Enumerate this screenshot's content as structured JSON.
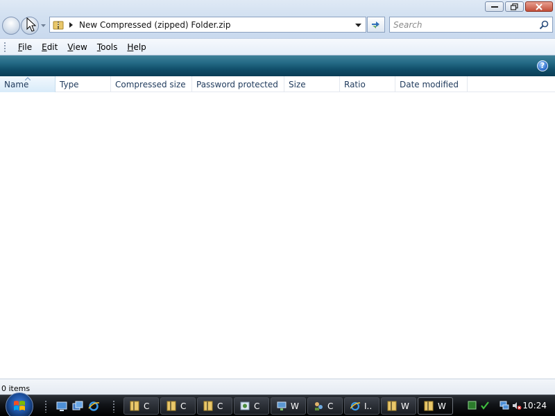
{
  "window": {
    "minimize_label": "minimize",
    "maximize_label": "maximize",
    "close_label": "close"
  },
  "address": {
    "path": "New Compressed (zipped) Folder.zip"
  },
  "search": {
    "placeholder": "Search"
  },
  "menu": {
    "items": [
      {
        "label": "File",
        "key": "F",
        "rest": "ile"
      },
      {
        "label": "Edit",
        "key": "E",
        "rest": "dit"
      },
      {
        "label": "View",
        "key": "V",
        "rest": "iew"
      },
      {
        "label": "Tools",
        "key": "T",
        "rest": "ools"
      },
      {
        "label": "Help",
        "key": "H",
        "rest": "elp"
      }
    ]
  },
  "command_bar": {
    "help_glyph": "?"
  },
  "columns": [
    {
      "label": "Name",
      "sorted": true
    },
    {
      "label": "Type"
    },
    {
      "label": "Compressed size"
    },
    {
      "label": "Password protected"
    },
    {
      "label": "Size"
    },
    {
      "label": "Ratio"
    },
    {
      "label": "Date modified"
    }
  ],
  "status": {
    "text": "0 items"
  },
  "taskbar": {
    "quick_launch": [
      "show-desktop-icon",
      "switch-windows-icon",
      "internet-explorer-icon"
    ],
    "tasks": [
      {
        "label": "C",
        "icon": "folder-icon"
      },
      {
        "label": "C",
        "icon": "folder-icon"
      },
      {
        "label": "C",
        "icon": "folder-icon"
      },
      {
        "label": "C",
        "icon": "control-panel-icon"
      },
      {
        "label": "W",
        "icon": "network-icon"
      },
      {
        "label": "C",
        "icon": "users-icon"
      },
      {
        "label": "I..",
        "icon": "internet-explorer-icon"
      },
      {
        "label": "W",
        "icon": "folder-icon"
      },
      {
        "label": "W",
        "icon": "folder-icon",
        "active": true
      }
    ],
    "clock": "10:24"
  },
  "colors": {
    "accent_command_bar": "#246a86",
    "nav_background": "#d3e1f1",
    "taskbar": "#111418"
  }
}
